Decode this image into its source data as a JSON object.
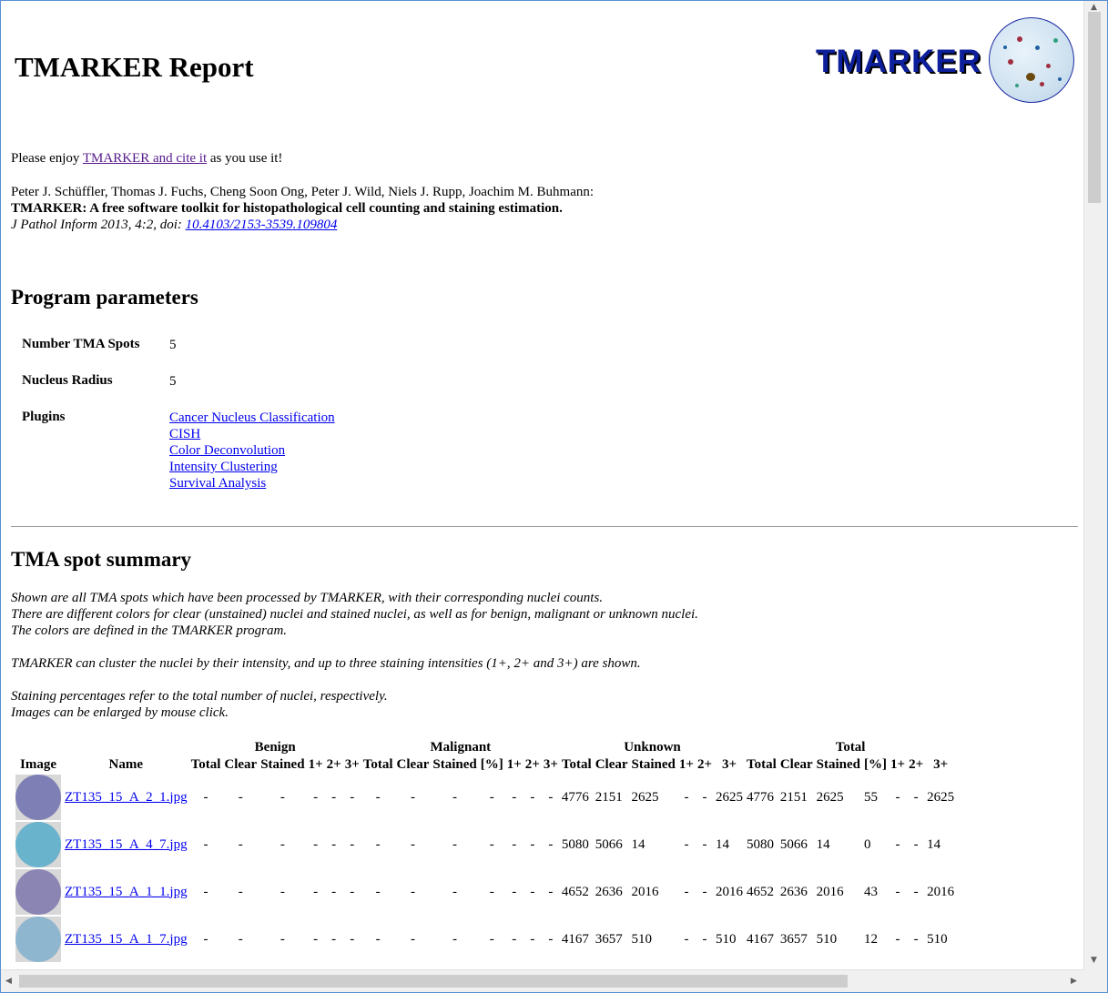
{
  "report": {
    "title": "TMARKER Report",
    "logo_text": "TMARKER"
  },
  "intro": {
    "prefix": "Please enjoy ",
    "link": "TMARKER and cite it",
    "suffix": " as you use it!",
    "authors": "Peter J. Schüffler, Thomas J. Fuchs, Cheng Soon Ong, Peter J. Wild, Niels J. Rupp, Joachim M. Buhmann:",
    "paper_title": "TMARKER: A free software toolkit for histopathological cell counting and staining estimation.",
    "journal": "J Pathol Inform 2013, 4:2, doi: ",
    "doi": "10.4103/2153-3539.109804"
  },
  "params": {
    "heading": "Program parameters",
    "spots_label": "Number TMA Spots",
    "spots_value": "5",
    "radius_label": "Nucleus Radius",
    "radius_value": "5",
    "plugins_label": "Plugins",
    "plugins": [
      "Cancer Nucleus Classification",
      "CISH",
      "Color Deconvolution",
      "Intensity Clustering",
      "Survival Analysis"
    ]
  },
  "summary": {
    "heading": "TMA spot summary",
    "lines": [
      "Shown are all TMA spots which have been processed by TMARKER, with their corresponding nuclei counts.",
      "There are different colors for clear (unstained) nuclei and stained nuclei, as well as for benign, malignant or unknown nuclei.",
      "The colors are defined in the TMARKER program.",
      "TMARKER can cluster the nuclei by their intensity, and up to three staining intensities (1+, 2+ and 3+) are shown.",
      "Staining percentages refer to the total number of nuclei, respectively.",
      "Images can be enlarged by mouse click."
    ]
  },
  "table": {
    "groups": [
      "Benign",
      "Malignant",
      "Unknown",
      "Total"
    ],
    "col_image": "Image",
    "col_name": "Name",
    "benign_cols": [
      "Total",
      "Clear",
      "Stained",
      "1+",
      "2+",
      "3+"
    ],
    "malignant_cols": [
      "Total",
      "Clear",
      "Stained",
      "[%]",
      "1+",
      "2+",
      "3+"
    ],
    "unknown_cols": [
      "Total",
      "Clear",
      "Stained",
      "1+",
      "2+",
      "3+"
    ],
    "total_cols": [
      "Total",
      "Clear",
      "Stained",
      "[%]",
      "1+",
      "2+",
      "3+"
    ],
    "rows": [
      {
        "name": "ZT135_15_A_2_1.jpg",
        "thumb_color": "#7e7fb4",
        "benign": [
          "-",
          "-",
          "-",
          "-",
          "-",
          "-"
        ],
        "malignant": [
          "-",
          "-",
          "-",
          "-",
          "-",
          "-",
          "-"
        ],
        "unknown": [
          "4776",
          "2151",
          "2625",
          "-",
          "-",
          "2625"
        ],
        "total": [
          "4776",
          "2151",
          "2625",
          "55",
          "-",
          "-",
          "2625"
        ]
      },
      {
        "name": "ZT135_15_A_4_7.jpg",
        "thumb_color": "#6ab3cc",
        "benign": [
          "-",
          "-",
          "-",
          "-",
          "-",
          "-"
        ],
        "malignant": [
          "-",
          "-",
          "-",
          "-",
          "-",
          "-",
          "-"
        ],
        "unknown": [
          "5080",
          "5066",
          "14",
          "-",
          "-",
          "14"
        ],
        "total": [
          "5080",
          "5066",
          "14",
          "0",
          "-",
          "-",
          "14"
        ]
      },
      {
        "name": "ZT135_15_A_1_1.jpg",
        "thumb_color": "#8a85b3",
        "benign": [
          "-",
          "-",
          "-",
          "-",
          "-",
          "-"
        ],
        "malignant": [
          "-",
          "-",
          "-",
          "-",
          "-",
          "-",
          "-"
        ],
        "unknown": [
          "4652",
          "2636",
          "2016",
          "-",
          "-",
          "2016"
        ],
        "total": [
          "4652",
          "2636",
          "2016",
          "43",
          "-",
          "-",
          "2016"
        ]
      },
      {
        "name": "ZT135_15_A_1_7.jpg",
        "thumb_color": "#8fb6cf",
        "benign": [
          "-",
          "-",
          "-",
          "-",
          "-",
          "-"
        ],
        "malignant": [
          "-",
          "-",
          "-",
          "-",
          "-",
          "-",
          "-"
        ],
        "unknown": [
          "4167",
          "3657",
          "510",
          "-",
          "-",
          "510"
        ],
        "total": [
          "4167",
          "3657",
          "510",
          "12",
          "-",
          "-",
          "510"
        ]
      }
    ]
  }
}
